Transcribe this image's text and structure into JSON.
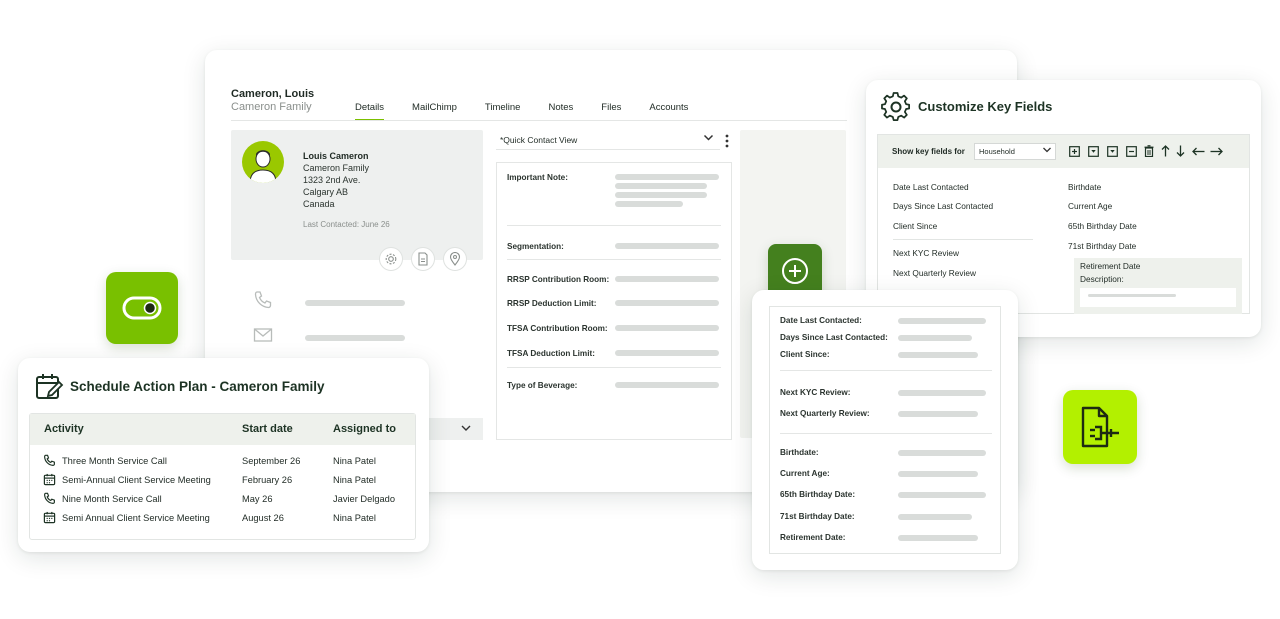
{
  "main": {
    "client_name": "Cameron, Louis",
    "client_family": "Cameron Family",
    "tabs": [
      "Details",
      "MailChimp",
      "Timeline",
      "Notes",
      "Files",
      "Accounts"
    ],
    "active_tab": "Details",
    "profile": {
      "name": "Louis Cameron",
      "family": "Cameron Family",
      "address1": "1323 2nd Ave.",
      "city": "Calgary AB",
      "country": "Canada",
      "last_contacted": "Last Contacted: June 26"
    },
    "quick_view": "*Quick Contact View",
    "fields": {
      "important_note": "Important Note:",
      "segmentation": "Segmentation:",
      "rrsp_room": "RRSP Contribution Room:",
      "rrsp_limit": "RRSP Deduction Limit:",
      "tfsa_room": "TFSA Contribution Room:",
      "tfsa_limit": "TFSA Deduction Limit:",
      "beverage": "Type of Beverage:"
    },
    "icons": [
      "phone-icon",
      "mail-icon",
      "gear-icon",
      "document-icon",
      "location-pin-icon"
    ]
  },
  "schedule": {
    "title": "Schedule Action Plan - Cameron Family",
    "headers": {
      "activity": "Activity",
      "start": "Start date",
      "assigned": "Assigned to"
    },
    "rows": [
      {
        "activity": "Three Month Service Call",
        "start": "September 26",
        "assigned": "Nina Patel",
        "icon": "phone-icon"
      },
      {
        "activity": "Semi-Annual Client Service Meeting",
        "start": "February 26",
        "assigned": "Nina Patel",
        "icon": "calendar-icon"
      },
      {
        "activity": "Nine Month Service Call",
        "start": "May 26",
        "assigned": "Javier Delgado",
        "icon": "phone-icon"
      },
      {
        "activity": "Semi Annual Client Service Meeting",
        "start": "August 26",
        "assigned": "Nina Patel",
        "icon": "calendar-icon"
      }
    ]
  },
  "customize": {
    "title": "Customize Key Fields",
    "show_label": "Show key fields for",
    "select_value": "Household",
    "left_fields": [
      "Date Last Contacted",
      "Days Since Last Contacted",
      "Client Since",
      "Next KYC Review",
      "Next Quarterly Review"
    ],
    "right_fields": [
      "Birthdate",
      "Current Age",
      "65th Birthday Date",
      "71st Birthday Date"
    ],
    "selected_field": "Retirement Date",
    "description_label": "Description:"
  },
  "keyfields": {
    "groups": [
      [
        "Date Last Contacted:",
        "Days Since Last Contacted:",
        "Client Since:"
      ],
      [
        "Next KYC Review:",
        "Next Quarterly Review:"
      ],
      [
        "Birthdate:",
        "Current Age:",
        "65th Birthday Date:",
        "71st Birthday Date:",
        "Retirement Date:"
      ]
    ]
  },
  "colors": {
    "accent": "#7cc000",
    "dark_green": "#44801e",
    "lime": "#b3f000",
    "panel_bg": "#eef1ec",
    "placeholder_bar": "#d9dcda"
  }
}
